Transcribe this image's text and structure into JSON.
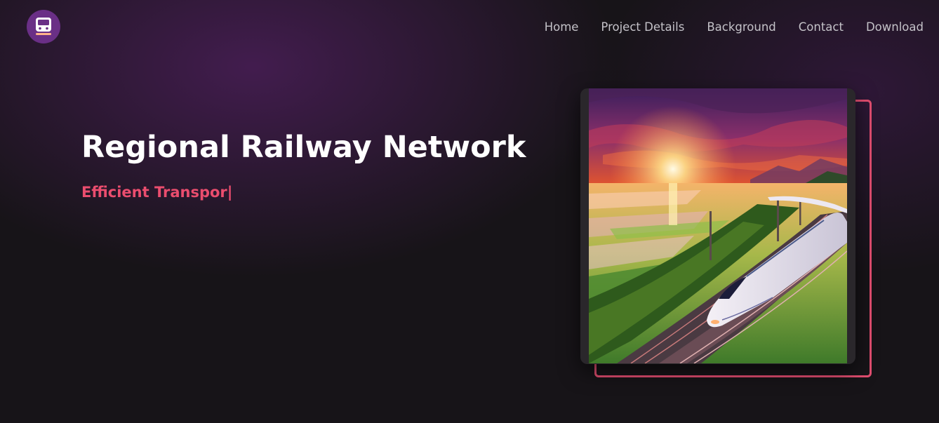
{
  "brand": {
    "logo_icon": "train-icon",
    "logo_color": "#6a2f86"
  },
  "nav": {
    "items": [
      {
        "label": "Home"
      },
      {
        "label": "Project Details"
      },
      {
        "label": "Background"
      },
      {
        "label": "Contact"
      },
      {
        "label": "Download"
      }
    ]
  },
  "hero": {
    "title": "Regional Railway Network",
    "subtitle": "Efficient Transpor",
    "cursor": "|"
  },
  "colors": {
    "background": "#171418",
    "accent": "#ea4d6e",
    "nav_text": "#c4c2c8"
  },
  "image": {
    "subject": "high-speed-train-sunset-photo"
  }
}
